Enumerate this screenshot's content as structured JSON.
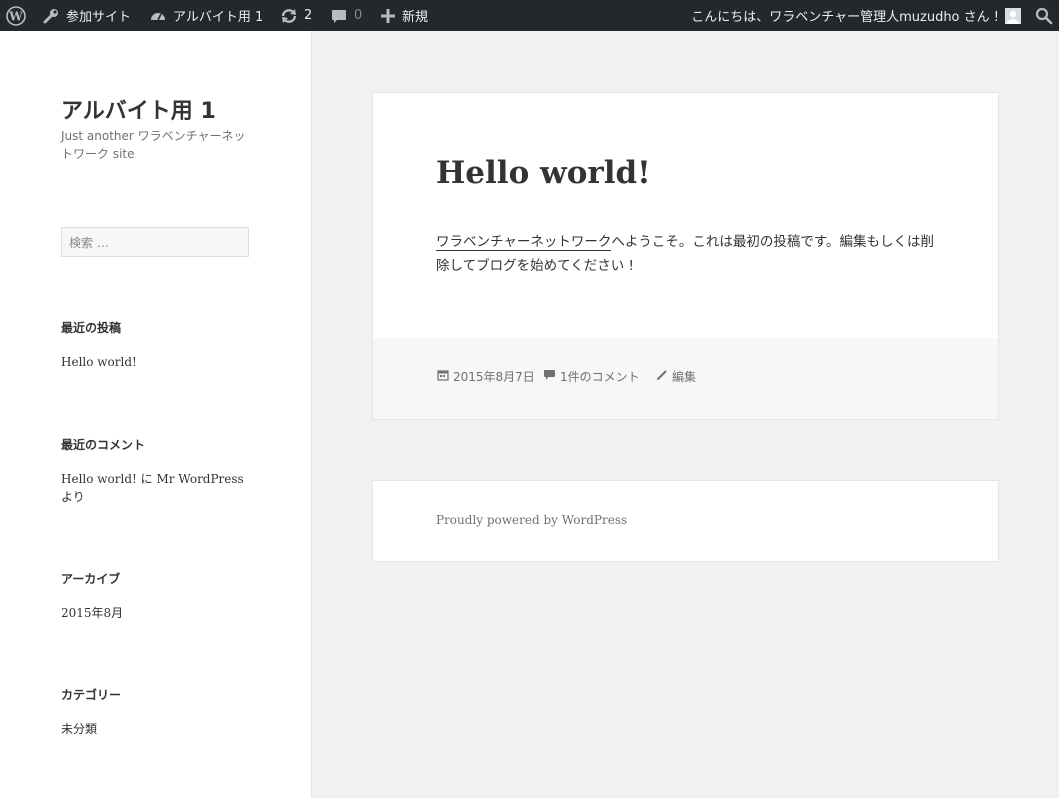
{
  "admin_bar": {
    "my_sites": "参加サイト",
    "site_name": "アルバイト用 1",
    "updates": "2",
    "comments": "0",
    "new": "新規",
    "greeting": "こんにちは、ワラベンチャー管理人muzudho さん !"
  },
  "site": {
    "title": "アルバイト用 1",
    "description": "Just another ワラベンチャーネットワーク site"
  },
  "search": {
    "placeholder": "検索 …"
  },
  "widgets": {
    "recent_posts": {
      "title": "最近の投稿",
      "items": [
        "Hello world!"
      ]
    },
    "recent_comments": {
      "title": "最近のコメント",
      "items": [
        "Hello world! に Mr WordPressより"
      ]
    },
    "archives": {
      "title": "アーカイブ",
      "items": [
        "2015年8月"
      ]
    },
    "categories": {
      "title": "カテゴリー",
      "items": [
        "未分類"
      ]
    }
  },
  "post": {
    "title": "Hello world!",
    "body_link": "ワラベンチャーネットワーク",
    "body_rest": "へようこそ。これは最初の投稿です。編集もしくは削除してブログを始めてください !",
    "date": "2015年8月7日",
    "comments": "1件のコメント",
    "edit": "編集"
  },
  "footer": {
    "text": "Proudly powered by WordPress"
  },
  "colors": {
    "admin_bar": "#23282d",
    "page_bg": "#f1f1f1",
    "card_bg": "#ffffff",
    "meta_text": "#707070"
  }
}
